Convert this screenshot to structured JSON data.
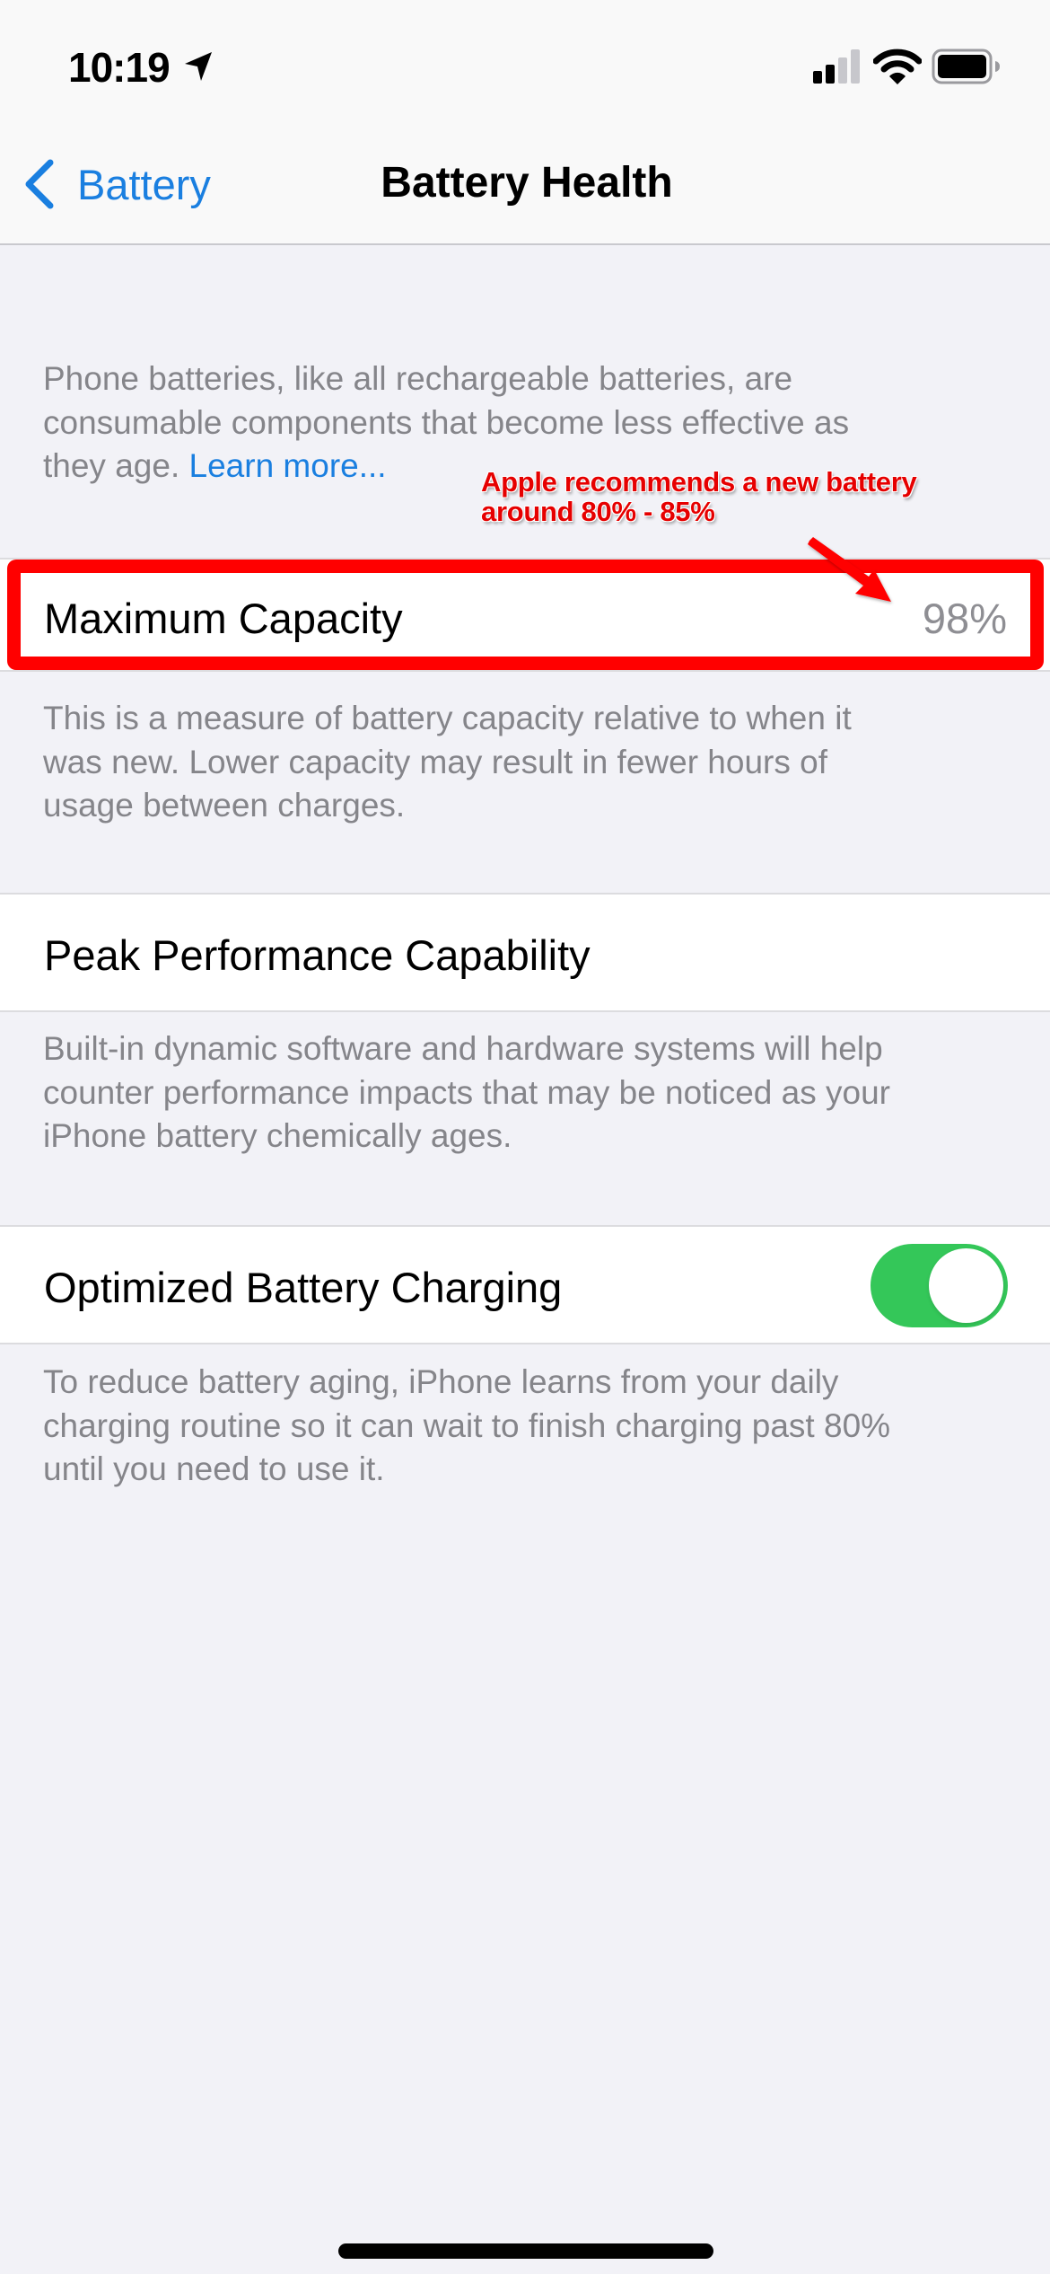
{
  "status_bar": {
    "time": "10:19",
    "location_icon": "location-arrow-icon",
    "signal_bars_filled": 2,
    "signal_bars_total": 4,
    "wifi_icon": "wifi-icon",
    "battery_icon": "battery-full-icon"
  },
  "nav": {
    "back_label": "Battery",
    "back_icon": "chevron-left-icon",
    "title": "Battery Health"
  },
  "intro_footer": {
    "lines": [
      "Phone batteries, like all rechargeable batteries, are",
      "consumable components that become less effective as",
      "they age. "
    ],
    "link": "Learn more..."
  },
  "maximum_capacity": {
    "label": "Maximum Capacity",
    "value": "98%"
  },
  "capacity_footer": {
    "lines": [
      "This is a measure of battery capacity relative to when it",
      "was new. Lower capacity may result in fewer hours of",
      "usage between charges."
    ]
  },
  "peak_performance": {
    "label": "Peak Performance Capability"
  },
  "peak_footer": {
    "lines": [
      "Built-in dynamic software and hardware systems will help",
      "counter performance impacts that may be noticed as your",
      "iPhone battery chemically ages."
    ]
  },
  "optimized_charging": {
    "label": "Optimized Battery Charging",
    "enabled": true
  },
  "optimized_footer": {
    "lines": [
      "To reduce battery aging, iPhone learns from your daily",
      "charging routine so it can wait to finish charging past 80%",
      "until you need to use it."
    ]
  },
  "annotation": {
    "lines": [
      "Apple recommends a new battery",
      "around 80% - 85%"
    ],
    "color": "#e60000"
  },
  "colors": {
    "accent": "#1a7fe0",
    "toggle_on": "#34c759",
    "background": "#f2f2f7",
    "annotation_red": "#ff0000"
  }
}
